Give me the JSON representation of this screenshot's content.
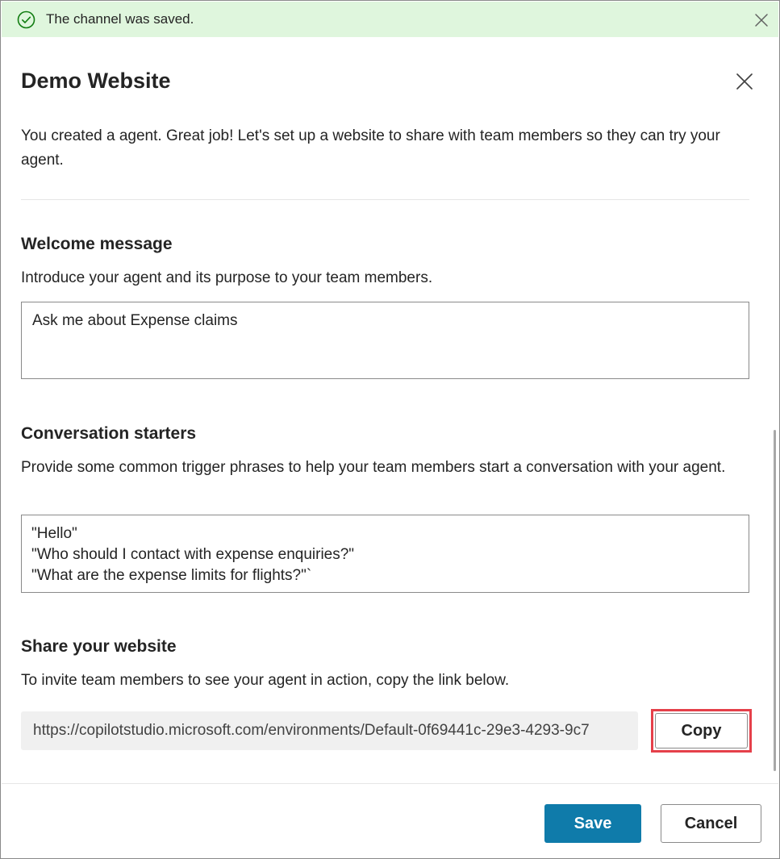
{
  "notification": {
    "icon": "check-circle-icon",
    "message": "The channel was saved.",
    "close_icon": "close-icon",
    "background": "#dff6dd",
    "icon_color": "#107c10"
  },
  "dialog": {
    "title": "Demo Website",
    "close_icon": "close-icon",
    "intro": "You created a agent. Great job! Let's set up a website to share with team members so they can try your agent."
  },
  "welcome": {
    "heading": "Welcome message",
    "description": "Introduce your agent and its purpose to your team members.",
    "value": "Ask me about Expense claims"
  },
  "starters": {
    "heading": "Conversation starters",
    "description": "Provide some common trigger phrases to help your team members start a conversation with your agent.",
    "lines": [
      "\"Hello\"",
      "\"Who should I contact with expense enquiries?\"",
      "\"What are the expense limits for flights?\"`"
    ]
  },
  "share": {
    "heading": "Share your website",
    "description": "To invite team members to see your agent in action, copy the link below.",
    "link": "https://copilotstudio.microsoft.com/environments/Default-0f69441c-29e3-4293-9c7",
    "copy_label": "Copy",
    "highlight_color": "#e5404a"
  },
  "footer": {
    "save_label": "Save",
    "cancel_label": "Cancel",
    "primary_color": "#0f7baa"
  }
}
